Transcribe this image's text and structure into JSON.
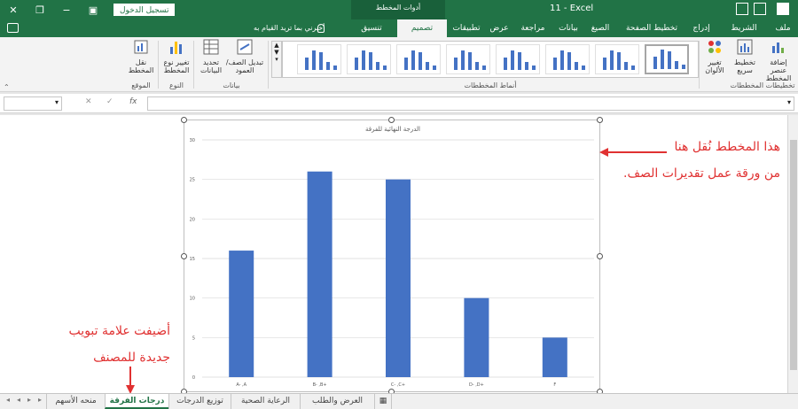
{
  "titlebar": {
    "doc_title": "11 - Excel",
    "login_button": "تسجيل الدخول",
    "context_tools": "أدوات المخطط"
  },
  "tabs": [
    {
      "label": "ملف"
    },
    {
      "label": "الشريط الرئيسي"
    },
    {
      "label": "إدراج"
    },
    {
      "label": "تخطيط الصفحة"
    },
    {
      "label": "الصيغ"
    },
    {
      "label": "بيانات"
    },
    {
      "label": "مراجعة"
    },
    {
      "label": "عرض"
    },
    {
      "label": "تطبيقات"
    },
    {
      "label": "تصميم المخطط"
    },
    {
      "label": "تنسيق"
    }
  ],
  "tell_me": "أخبرني بما تريد القيام به",
  "ribbon": {
    "add_element": "إضافة عنصر المخطط",
    "quick_layout": "تخطيط سريع",
    "change_colors": "تغيير الألوان",
    "group_layouts": "تخطيطات المخططات",
    "group_styles": "أنماط المخططات",
    "switch_row_col": "تبديل الصف/ العمود",
    "select_data": "تحديد البيانات",
    "group_data": "بيانات",
    "change_type": "تغيير نوع المخطط",
    "group_type": "النوع",
    "move_chart": "نقل المخطط",
    "group_location": "الموقع"
  },
  "formula_bar": {
    "fx": "fx",
    "cancel": "✕",
    "enter": "✓"
  },
  "chart_data": {
    "type": "bar",
    "title": "الدرجة النهائية للفرقة",
    "categories": [
      "A- ,A",
      "B- ,B+",
      "C- ,C+",
      "D- ,D+",
      "F"
    ],
    "values": [
      16,
      26,
      25,
      10,
      5
    ],
    "y_ticks": [
      "0",
      "5",
      "10",
      "15",
      "20",
      "25",
      "30"
    ],
    "ylim": [
      0,
      30
    ],
    "grid": true,
    "bar_color": "#4472c4"
  },
  "annotations": {
    "right_line1": "هذا المخطط نُقل هنا",
    "right_line2": "من ورقة عمل تقديرات الصف.",
    "left_line1": "أضيفت علامة تبويب",
    "left_line2": "جديدة للمصنف",
    "color": "#e03131"
  },
  "sheet_tabs": [
    {
      "label": "منحه الأسهم"
    },
    {
      "label": "درجات الفرقة"
    },
    {
      "label": "توزيع الدرجات"
    },
    {
      "label": "الرعاية الصحية"
    },
    {
      "label": "العرض والطلب"
    }
  ],
  "colors": {
    "excel_green": "#217346",
    "accent_red": "#e03131"
  }
}
